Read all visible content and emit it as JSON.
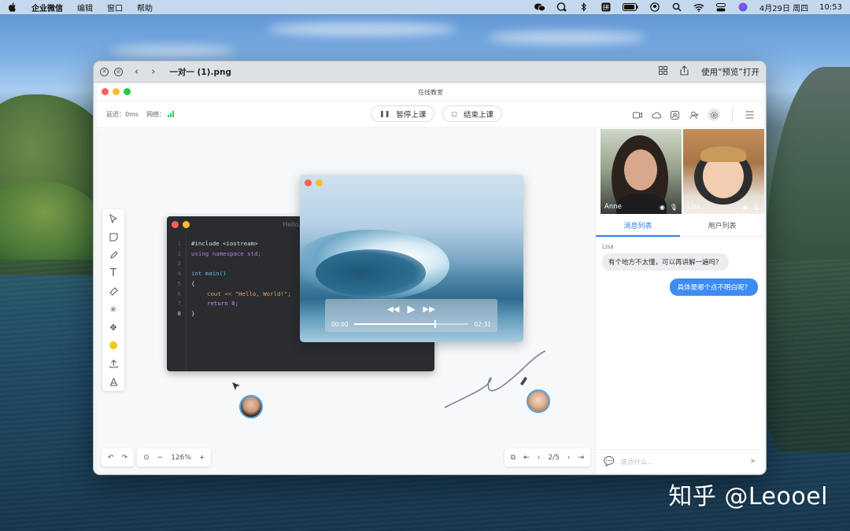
{
  "menubar": {
    "app_name": "企业微信",
    "items": [
      "编辑",
      "窗口",
      "帮助"
    ],
    "date": "4月29日 周四",
    "time": "10:53"
  },
  "preview": {
    "filename": "一对一 (1).png",
    "open_with": "使用“预览”打开"
  },
  "app": {
    "title": "在线教室",
    "latency_label": "延迟：",
    "latency_value": "0ms",
    "network_label": "网络：",
    "pause_label": "暂停上课",
    "end_label": "结束上课"
  },
  "code": {
    "window_title": "Hello,",
    "lines": [
      {
        "n": "1",
        "text": "#include <iostream>"
      },
      {
        "n": "2",
        "text": "using namespace std;"
      },
      {
        "n": "3",
        "text": ""
      },
      {
        "n": "4",
        "text": "int main()"
      },
      {
        "n": "5",
        "text": "{"
      },
      {
        "n": "6",
        "text": "cout << \"Hello, World!\";"
      },
      {
        "n": "7",
        "text": "return 0;"
      },
      {
        "n": "8",
        "text": "}"
      }
    ]
  },
  "video": {
    "elapsed": "00:00",
    "duration": "02:31",
    "progress": 0.7
  },
  "canvas": {
    "zoom": "126%",
    "page": "2/5"
  },
  "participants": [
    {
      "name": "Anne"
    },
    {
      "name": "Lisa"
    }
  ],
  "tabs": {
    "messages": "消息列表",
    "users": "用户列表"
  },
  "chat": {
    "sender": "Lisa",
    "incoming": "有个地方不太懂，可以再讲解一遍吗？",
    "outgoing": "具体是哪个点不明白呢？",
    "placeholder": "说点什么..."
  },
  "watermark": "知乎 @Leooel",
  "colors": {
    "accent": "#2f7ff0",
    "bubble_outgoing": "#3d8bf5",
    "close": "#ff5f57",
    "minimize": "#febc2e",
    "zoom": "#28c840"
  }
}
